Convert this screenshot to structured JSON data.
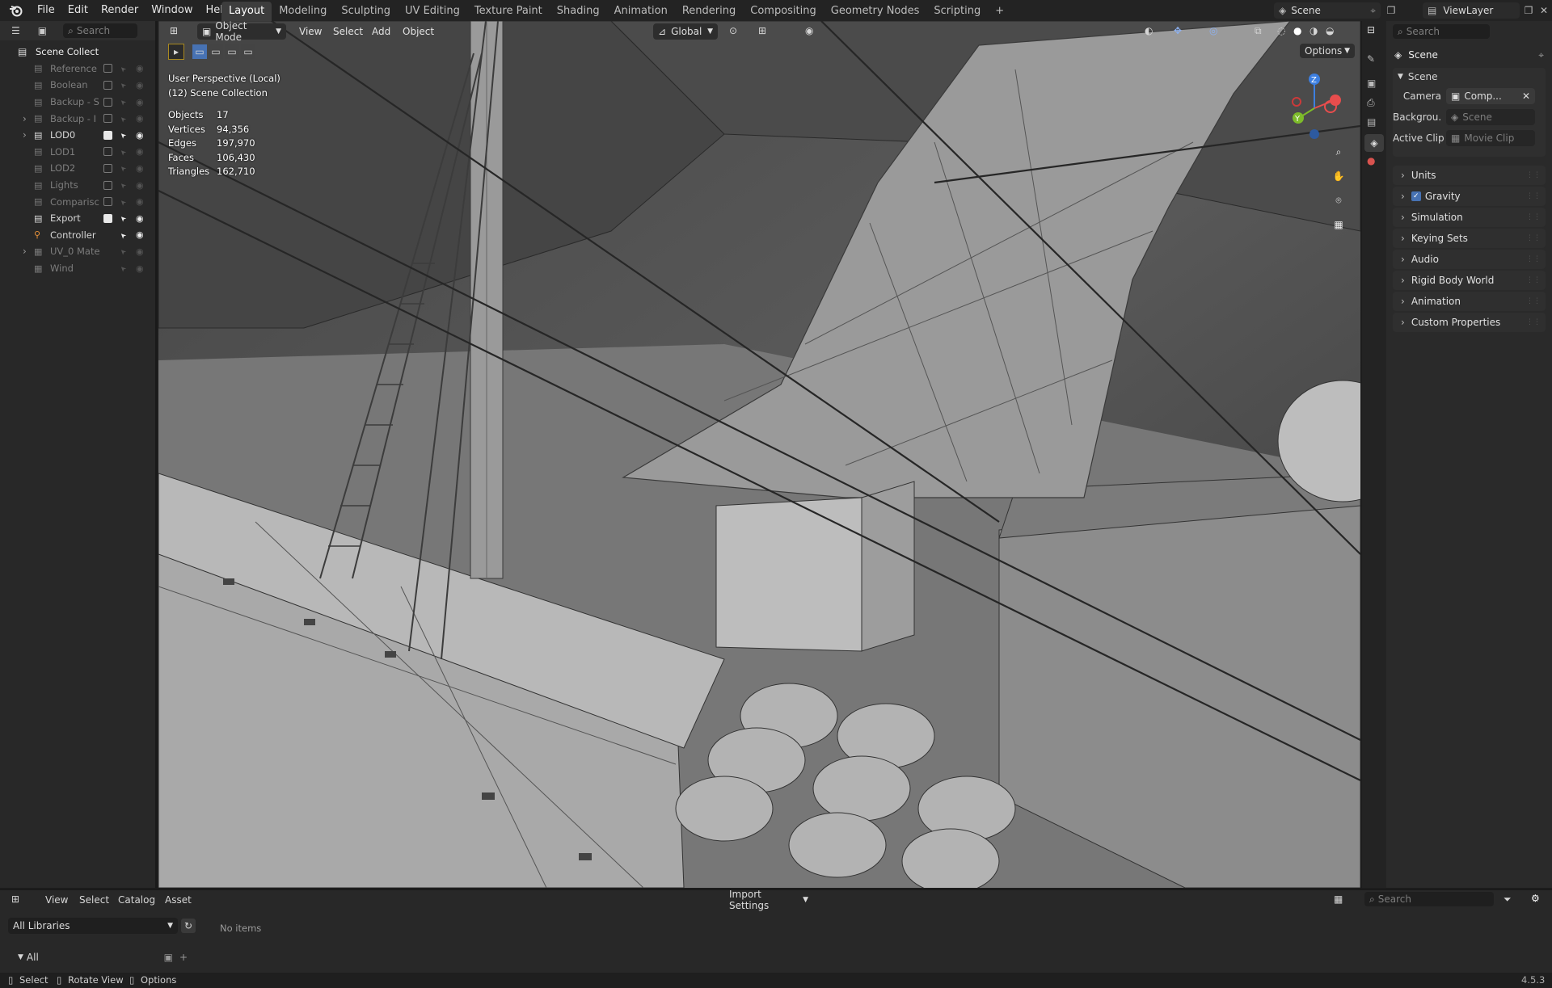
{
  "topbar": {
    "menus": [
      "File",
      "Edit",
      "Render",
      "Window",
      "Help"
    ],
    "workspaces": [
      "Layout",
      "Modeling",
      "Sculpting",
      "UV Editing",
      "Texture Paint",
      "Shading",
      "Animation",
      "Rendering",
      "Compositing",
      "Geometry Nodes",
      "Scripting"
    ],
    "active_workspace": "Layout",
    "add_tab": "+",
    "scene_name": "Scene",
    "view_layer": "ViewLayer"
  },
  "outliner": {
    "search_placeholder": "Search",
    "root": "Scene Collecti",
    "items": [
      {
        "label": "Reference",
        "dim": true,
        "checked": false
      },
      {
        "label": "Boolean",
        "dim": true,
        "checked": false
      },
      {
        "label": "Backup - S",
        "dim": true,
        "checked": false
      },
      {
        "label": "Backup - I",
        "dim": true,
        "checked": false
      },
      {
        "label": "LOD0",
        "dim": false,
        "checked": true
      },
      {
        "label": "LOD1",
        "dim": true,
        "checked": false
      },
      {
        "label": "LOD2",
        "dim": true,
        "checked": false
      },
      {
        "label": "Lights",
        "dim": true,
        "checked": false
      },
      {
        "label": "Comparisc",
        "dim": true,
        "checked": false
      },
      {
        "label": "Export",
        "dim": false,
        "checked": true
      },
      {
        "label": "Controller",
        "dim": false,
        "checked": null
      },
      {
        "label": "UV_0 Mate",
        "dim": true,
        "checked": null
      },
      {
        "label": "Wind",
        "dim": true,
        "checked": null
      }
    ]
  },
  "viewport": {
    "mode": "Object Mode",
    "menus": [
      "View",
      "Select",
      "Add",
      "Object"
    ],
    "orientation": "Global",
    "options": "Options",
    "perspective": "User Perspective (Local)",
    "collection": "(12) Scene Collection",
    "stats": [
      {
        "k": "Objects",
        "v": "17"
      },
      {
        "k": "Vertices",
        "v": "94,356"
      },
      {
        "k": "Edges",
        "v": "197,970"
      },
      {
        "k": "Faces",
        "v": "106,430"
      },
      {
        "k": "Triangles",
        "v": "162,710"
      }
    ],
    "gizmo": {
      "x": "X",
      "y": "Y",
      "z": "Z"
    }
  },
  "properties": {
    "search_placeholder": "Search",
    "context": "Scene",
    "panel": "Scene",
    "camera_label": "Camera",
    "camera_value": "Comp...",
    "background_label": "Backgrou...",
    "background_value": "Scene",
    "clip_label": "Active Clip",
    "clip_value": "Movie Clip",
    "sections": [
      "Units",
      "Gravity",
      "Simulation",
      "Keying Sets",
      "Audio",
      "Rigid Body World",
      "Animation",
      "Custom Properties"
    ]
  },
  "assets": {
    "menus": [
      "View",
      "Select",
      "Catalog",
      "Asset"
    ],
    "import_settings": "Import Settings",
    "library": "All Libraries",
    "catalog_all": "All",
    "empty": "No items",
    "search_placeholder": "Search"
  },
  "status": {
    "select": "Select",
    "rotate": "Rotate View",
    "options": "Options",
    "version": "4.5.3"
  },
  "colors": {
    "accent": "#4772b3",
    "x_axis": "#e84d4d",
    "y_axis": "#7dbb2a",
    "z_axis": "#3d7fe0"
  }
}
